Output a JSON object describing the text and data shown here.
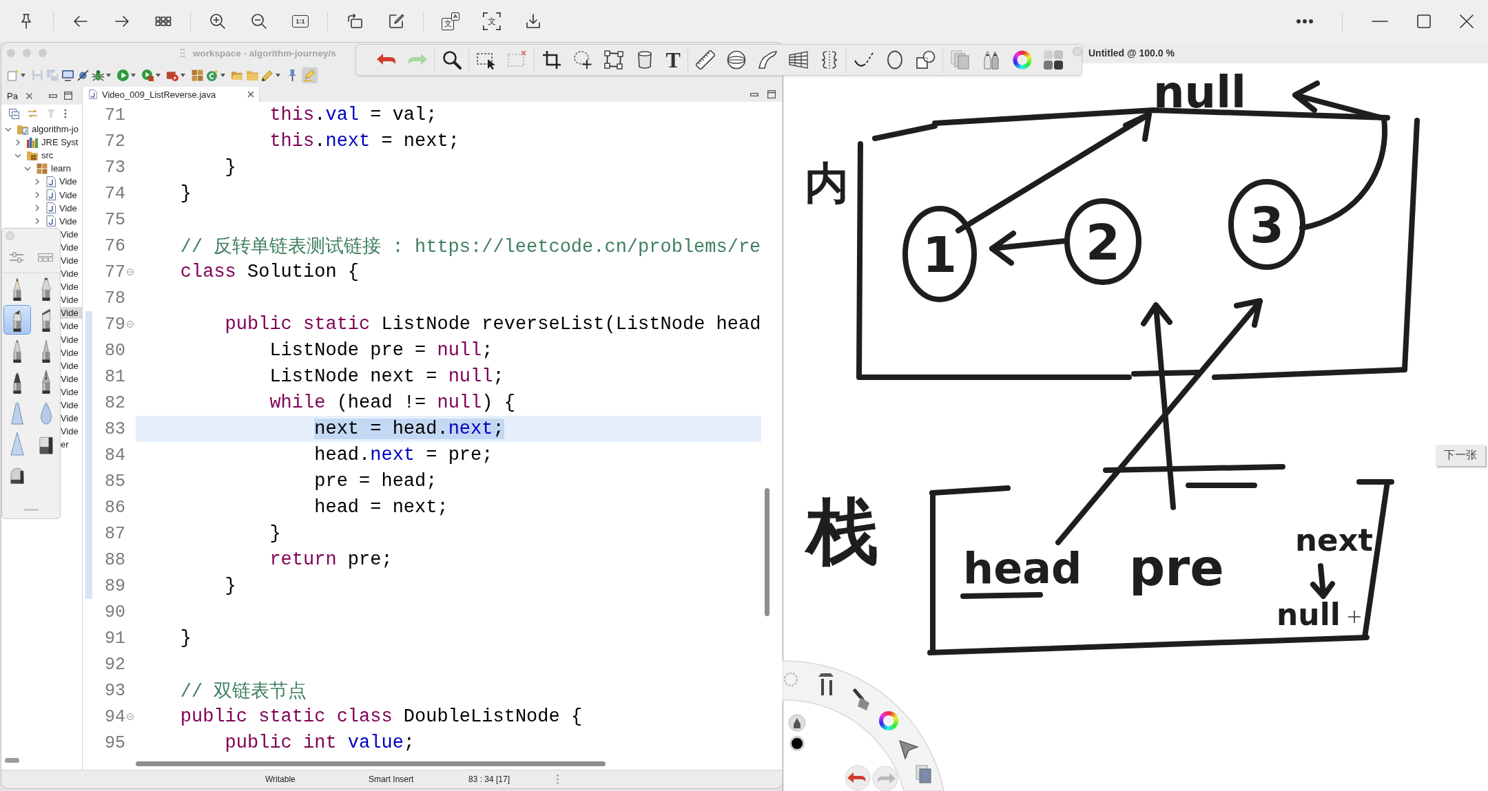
{
  "viewer_toolbar": {
    "zoom_reset_label": "1:1",
    "translate_glyphs": [
      "文",
      "A"
    ],
    "ocr_glyph": "文"
  },
  "eclipse": {
    "title": "workspace - algorithm-journey/s",
    "toolbar_buttons": [
      {
        "disabled": false,
        "on": false
      },
      {
        "disabled": true,
        "on": false
      },
      {
        "disabled": true,
        "on": false
      },
      {
        "disabled": false,
        "on": false
      },
      {
        "disabled": false,
        "on": false
      },
      {
        "disabled": false,
        "on": false
      },
      {
        "disabled": false,
        "on": false
      },
      {
        "disabled": false,
        "on": false
      },
      {
        "disabled": false,
        "on": false
      },
      {
        "disabled": false,
        "on": false
      },
      {
        "disabled": false,
        "on": false
      },
      {
        "disabled": false,
        "on": false
      },
      {
        "disabled": false,
        "on": false
      },
      {
        "disabled": false,
        "on": false
      },
      {
        "disabled": false,
        "on": false
      },
      {
        "disabled": false,
        "on": true
      }
    ],
    "package_explorer": {
      "tab": "Pa",
      "tree": [
        {
          "label": "algorithm-jo",
          "kind": "project",
          "expanded": true,
          "selected": false,
          "children": [
            {
              "label": "JRE Syst",
              "kind": "library",
              "expanded": false,
              "selected": false
            },
            {
              "label": "src",
              "kind": "source-folder",
              "expanded": true,
              "selected": false,
              "children": [
                {
                  "label": "learn",
                  "kind": "package",
                  "expanded": true,
                  "selected": false,
                  "children": [
                    {
                      "label": "Vide",
                      "kind": "java-file",
                      "expanded": false,
                      "selected": false
                    },
                    {
                      "label": "Vide",
                      "kind": "java-file",
                      "expanded": false,
                      "selected": false
                    },
                    {
                      "label": "Vide",
                      "kind": "java-file",
                      "expanded": false,
                      "selected": false
                    },
                    {
                      "label": "Vide",
                      "kind": "java-file",
                      "expanded": false,
                      "selected": false
                    },
                    {
                      "label": "Vide",
                      "selected": false
                    },
                    {
                      "label": "Vide",
                      "selected": false
                    },
                    {
                      "label": "Vide",
                      "selected": false
                    },
                    {
                      "label": "Vide",
                      "selected": false
                    },
                    {
                      "label": "Vide",
                      "selected": false
                    },
                    {
                      "label": "Vide",
                      "selected": false
                    },
                    {
                      "label": "Vide",
                      "selected": true
                    },
                    {
                      "label": "Vide",
                      "selected": false
                    },
                    {
                      "label": "Vide",
                      "selected": false
                    },
                    {
                      "label": "Vide",
                      "selected": false
                    },
                    {
                      "label": "Vide",
                      "selected": false
                    },
                    {
                      "label": "Vide",
                      "selected": false
                    },
                    {
                      "label": "Vide",
                      "selected": false
                    },
                    {
                      "label": "Vide",
                      "selected": false
                    },
                    {
                      "label": "Vide",
                      "selected": false
                    },
                    {
                      "label": "Vide",
                      "selected": false
                    },
                    {
                      "label": "er",
                      "selected": false
                    }
                  ]
                }
              ]
            }
          ]
        }
      ]
    },
    "editor": {
      "tab": "Video_009_ListReverse.java",
      "lines": [
        {
          "number": "71",
          "current": false,
          "selected": false,
          "in_range": false,
          "tokens": [
            {
              "kind": "keyword",
              "text": "            this"
            },
            {
              "kind": "plain",
              "text": "."
            },
            {
              "kind": "field",
              "text": "val"
            },
            {
              "kind": "plain",
              "text": " = val;"
            }
          ]
        },
        {
          "number": "72",
          "current": false,
          "selected": false,
          "in_range": false,
          "tokens": [
            {
              "kind": "keyword",
              "text": "            this"
            },
            {
              "kind": "plain",
              "text": "."
            },
            {
              "kind": "field",
              "text": "next"
            },
            {
              "kind": "plain",
              "text": " = next;"
            }
          ]
        },
        {
          "number": "73",
          "current": false,
          "selected": false,
          "in_range": false,
          "tokens": [
            {
              "kind": "plain",
              "text": "        }"
            }
          ]
        },
        {
          "number": "74",
          "current": false,
          "selected": false,
          "in_range": false,
          "tokens": [
            {
              "kind": "plain",
              "text": "    }"
            }
          ]
        },
        {
          "number": "75",
          "current": false,
          "in_range": false
        },
        {
          "number": "76",
          "current": false,
          "selected": false,
          "in_range": false,
          "tokens": [
            {
              "kind": "comment",
              "text": "    // 反转单链表测试链接 : https://leetcode.cn/problems/re"
            }
          ]
        },
        {
          "number": "77",
          "current": false,
          "selected": false,
          "in_range": false,
          "folded": false,
          "tokens": [
            {
              "kind": "keyword",
              "text": "    class"
            },
            {
              "kind": "plain",
              "text": " Solution {"
            }
          ]
        },
        {
          "number": "78",
          "current": false,
          "in_range": false
        },
        {
          "number": "79",
          "current": false,
          "selected": false,
          "in_range": true,
          "folded": false,
          "tokens": [
            {
              "kind": "keyword",
              "text": "        public static"
            },
            {
              "kind": "plain",
              "text": " ListNode reverseList(ListNode head"
            }
          ]
        },
        {
          "number": "80",
          "current": false,
          "selected": false,
          "in_range": true,
          "tokens": [
            {
              "kind": "plain",
              "text": "            ListNode pre = "
            },
            {
              "kind": "keyword",
              "text": "null"
            },
            {
              "kind": "plain",
              "text": ";"
            }
          ]
        },
        {
          "number": "81",
          "current": false,
          "selected": false,
          "in_range": true,
          "tokens": [
            {
              "kind": "plain",
              "text": "            ListNode next = "
            },
            {
              "kind": "keyword",
              "text": "null"
            },
            {
              "kind": "plain",
              "text": ";"
            }
          ]
        },
        {
          "number": "82",
          "current": false,
          "selected": false,
          "in_range": true,
          "tokens": [
            {
              "kind": "keyword",
              "text": "            while"
            },
            {
              "kind": "plain",
              "text": " (head != "
            },
            {
              "kind": "keyword",
              "text": "null"
            },
            {
              "kind": "plain",
              "text": ") {"
            }
          ]
        },
        {
          "number": "83",
          "current": true,
          "selected": true,
          "in_range": true,
          "tokens": [
            {
              "kind": "plain",
              "text": "                next = head."
            },
            {
              "kind": "field",
              "text": "next"
            },
            {
              "kind": "plain",
              "text": ";"
            }
          ]
        },
        {
          "number": "84",
          "current": false,
          "selected": false,
          "in_range": true,
          "tokens": [
            {
              "kind": "plain",
              "text": "                head."
            },
            {
              "kind": "field",
              "text": "next"
            },
            {
              "kind": "plain",
              "text": " = pre;"
            }
          ]
        },
        {
          "number": "85",
          "current": false,
          "selected": false,
          "in_range": true,
          "tokens": [
            {
              "kind": "plain",
              "text": "                pre = head;"
            }
          ]
        },
        {
          "number": "86",
          "current": false,
          "selected": false,
          "in_range": true,
          "tokens": [
            {
              "kind": "plain",
              "text": "                head = next;"
            }
          ]
        },
        {
          "number": "87",
          "current": false,
          "selected": false,
          "in_range": true,
          "tokens": [
            {
              "kind": "plain",
              "text": "            }"
            }
          ]
        },
        {
          "number": "88",
          "current": false,
          "selected": false,
          "in_range": true,
          "tokens": [
            {
              "kind": "keyword",
              "text": "            return"
            },
            {
              "kind": "plain",
              "text": " pre;"
            }
          ]
        },
        {
          "number": "89",
          "current": false,
          "selected": false,
          "in_range": true,
          "tokens": [
            {
              "kind": "plain",
              "text": "        }"
            }
          ]
        },
        {
          "number": "90",
          "current": false,
          "in_range": false
        },
        {
          "number": "91",
          "current": false,
          "selected": false,
          "in_range": false,
          "tokens": [
            {
              "kind": "plain",
              "text": "    }"
            }
          ]
        },
        {
          "number": "92",
          "current": false,
          "in_range": false
        },
        {
          "number": "93",
          "current": false,
          "selected": false,
          "in_range": false,
          "tokens": [
            {
              "kind": "comment",
              "text": "    // 双链表节点"
            }
          ]
        },
        {
          "number": "94",
          "current": false,
          "selected": false,
          "in_range": false,
          "folded": false,
          "tokens": [
            {
              "kind": "keyword",
              "text": "    public static class"
            },
            {
              "kind": "plain",
              "text": " DoubleListNode {"
            }
          ]
        },
        {
          "number": "95",
          "current": false,
          "selected": false,
          "in_range": false,
          "tokens": [
            {
              "kind": "keyword",
              "text": "        public int"
            },
            {
              "kind": "field",
              "text": " value"
            },
            {
              "kind": "plain",
              "text": ";"
            }
          ]
        }
      ]
    },
    "status_bar": [
      "Writable",
      "Smart Insert",
      "83 : 34 [17]"
    ]
  },
  "drawing_toolbar": {
    "text_tool_label": "T"
  },
  "brush_palette": {
    "brushes": [
      {
        "selected": false
      },
      {
        "selected": false
      },
      {
        "selected": true
      },
      {
        "selected": false
      },
      {
        "selected": false
      },
      {
        "selected": false
      },
      {
        "selected": false
      },
      {
        "selected": false
      },
      {
        "selected": false
      },
      {
        "selected": false
      },
      {
        "selected": false
      },
      {
        "selected": false
      },
      {
        "selected": false
      }
    ]
  },
  "canvas_window": {
    "title": "Untitled @ 100.0 %",
    "sketch": {
      "null_label": "null",
      "regions": [
        "内",
        "栈"
      ],
      "nodes": [
        "1",
        "2",
        "3"
      ],
      "variables": [
        {
          "label": "head",
          "underlined": true
        },
        {
          "label": "pre",
          "underlined": false
        },
        {
          "label": "next",
          "underlined": false
        }
      ],
      "next_value": "null"
    },
    "next_button": "下一张"
  }
}
